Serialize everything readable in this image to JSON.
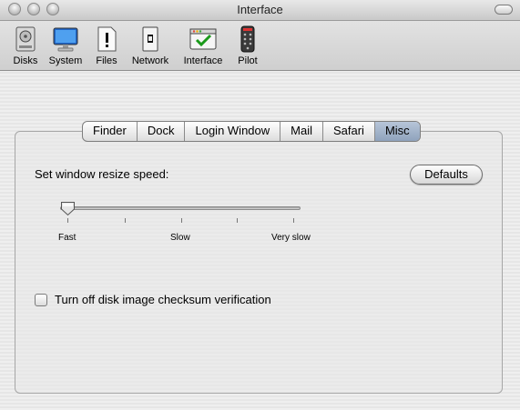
{
  "window": {
    "title": "Interface"
  },
  "toolbar": {
    "items": [
      {
        "label": "Disks",
        "icon": "disk-icon"
      },
      {
        "label": "System",
        "icon": "monitor-icon"
      },
      {
        "label": "Files",
        "icon": "file-icon"
      },
      {
        "label": "Network",
        "icon": "network-icon"
      },
      {
        "label": "Interface",
        "icon": "interface-icon"
      },
      {
        "label": "Pilot",
        "icon": "remote-icon"
      }
    ]
  },
  "tabs": [
    {
      "label": "Finder",
      "active": false
    },
    {
      "label": "Dock",
      "active": false
    },
    {
      "label": "Login Window",
      "active": false
    },
    {
      "label": "Mail",
      "active": false
    },
    {
      "label": "Safari",
      "active": false
    },
    {
      "label": "Misc",
      "active": true
    }
  ],
  "misc": {
    "resize_label": "Set window resize speed:",
    "defaults_button": "Defaults",
    "slider": {
      "min_label": "Fast",
      "mid_label": "Slow",
      "max_label": "Very slow",
      "value": 0
    },
    "checksum_label": "Turn off disk image checksum verification",
    "checksum_checked": false
  }
}
